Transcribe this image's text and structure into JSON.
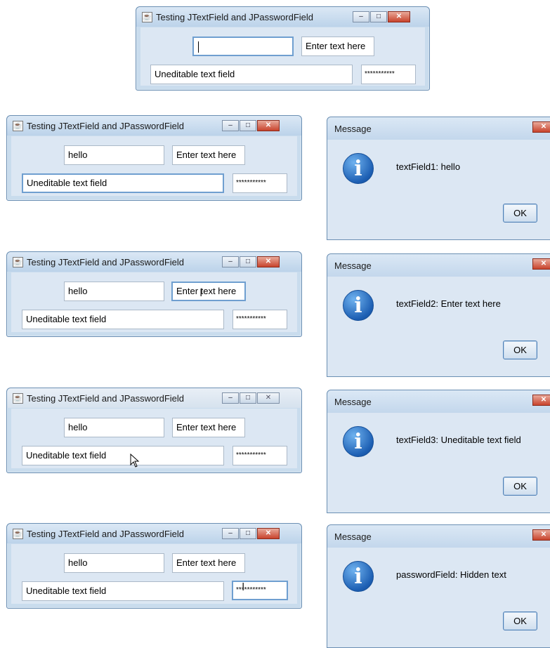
{
  "window_title": "Testing JTextField and JPasswordField",
  "textfield1_value": "hello",
  "textfield2_value": "Enter text here",
  "textfield3_value": "Uneditable text field",
  "password_mask": "***********",
  "controls": {
    "minimize": "–",
    "maximize": "□",
    "close": "✕"
  },
  "message_dialog": {
    "title": "Message",
    "ok_label": "OK",
    "messages": [
      "textField1: hello",
      "textField2: Enter text here",
      "textField3: Uneditable text field",
      "passwordField: Hidden text"
    ]
  },
  "colors": {
    "accent_border": "#6f9fd0",
    "close_red": "#c8432c",
    "info_blue": "#1d5fb3"
  },
  "icons": [
    "java-icon",
    "information-icon",
    "text-cursor-icon",
    "arrow-pointer-icon"
  ]
}
